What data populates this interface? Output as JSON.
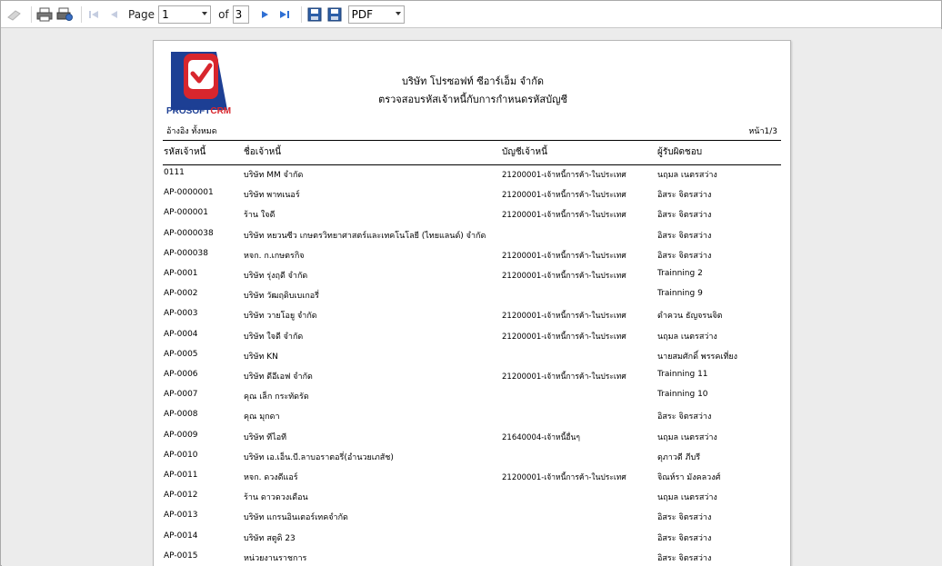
{
  "toolbar": {
    "page_label": "Page",
    "current_page": "1",
    "of_label": "of",
    "total_pages": "3",
    "export_format": "PDF"
  },
  "report": {
    "logo_text_a": "PROSOFT",
    "logo_text_b": "CRM",
    "company": "บริษัท โปรซอฟท์ ซีอาร์เอ็ม จำกัด",
    "title": "ตรวจสอบรหัสเจ้าหนี้กับการกำหนดรหัสบัญชี",
    "filter": "อ้างอิง ทั้งหมด",
    "page_info": "หน้า1/3",
    "headers": [
      "รหัสเจ้าหนี้",
      "ชื่อเจ้าหนี้",
      "บัญชีเจ้าหนี้",
      "ผู้รับผิดชอบ"
    ],
    "rows": [
      [
        "0111",
        "บริษัท MM จำกัด",
        "21200001-เจ้าหนี้การค้า-ในประเทศ",
        "นฤมล เนตรสว่าง"
      ],
      [
        "AP-0000001",
        "บริษัท พาทเนอร์",
        "21200001-เจ้าหนี้การค้า-ในประเทศ",
        "อิสระ จิตรสว่าง"
      ],
      [
        "AP-000001",
        "ร้าน ใจดี",
        "21200001-เจ้าหนี้การค้า-ในประเทศ",
        "อิสระ จิตรสว่าง"
      ],
      [
        "AP-0000038",
        "บริษัท หยวนซีว เกษตรวิทยาศาสตร์และเทคโนโลยี (ไทยแลนด์) จำกัด",
        "",
        "อิสระ จิตรสว่าง"
      ],
      [
        "AP-000038",
        "หจก. ก.เกษตรกิจ",
        "21200001-เจ้าหนี้การค้า-ในประเทศ",
        "อิสระ จิตรสว่าง"
      ],
      [
        "AP-0001",
        "บริษัท รุ่งฤดี จำกัด",
        "21200001-เจ้าหนี้การค้า-ในประเทศ",
        "Trainning 2"
      ],
      [
        "AP-0002",
        "บริษัท วัฒฤดิบเบเกอรี่",
        "",
        "Trainning 9"
      ],
      [
        "AP-0003",
        "บริษัท วายโอยู จำกัด",
        "21200001-เจ้าหนี้การค้า-ในประเทศ",
        "ดำควน ธัญจรนจิต"
      ],
      [
        "AP-0004",
        "บริษัท ใจดี จำกัด",
        "21200001-เจ้าหนี้การค้า-ในประเทศ",
        "นฤมล เนตรสว่าง"
      ],
      [
        "AP-0005",
        "บริษัท KN",
        "",
        "นายสมศักดิ์ พรรคเที่ยง"
      ],
      [
        "AP-0006",
        "บริษัท ดีอีเอฟ จำกัด",
        "21200001-เจ้าหนี้การค้า-ในประเทศ",
        "Trainning 11"
      ],
      [
        "AP-0007",
        "คุณ เล็ก กระทัดรัด",
        "",
        "Trainning 10"
      ],
      [
        "AP-0008",
        "คุณ มุกดา",
        "",
        "อิสระ จิตรสว่าง"
      ],
      [
        "AP-0009",
        "บริษัท ทีไอที",
        "21640004-เจ้าหนี้อื่นๆ",
        "นฤมล เนตรสว่าง"
      ],
      [
        "AP-0010",
        "บริษัท เอ.เอ็น.บี.ลาบอราตอรี่(อำนวยเภสัช)",
        "",
        "ดุภาวดี ภีบรี"
      ],
      [
        "AP-0011",
        "หจก. ดวงดีแอร์",
        "21200001-เจ้าหนี้การค้า-ในประเทศ",
        "จิณห์รา มังคลวงศ์"
      ],
      [
        "AP-0012",
        "ร้าน ดาวดวงเดือน",
        "",
        "นฤมล เนตรสว่าง"
      ],
      [
        "AP-0013",
        "บริษัท แกรนอินเตอร์เทคจำกัด",
        "",
        "อิสระ จิตรสว่าง"
      ],
      [
        "AP-0014",
        "บริษัท สตูดิ 23",
        "",
        "อิสระ จิตรสว่าง"
      ],
      [
        "AP-0015",
        "หน่วยงานราชการ",
        "",
        "อิสระ จิตรสว่าง"
      ]
    ]
  }
}
